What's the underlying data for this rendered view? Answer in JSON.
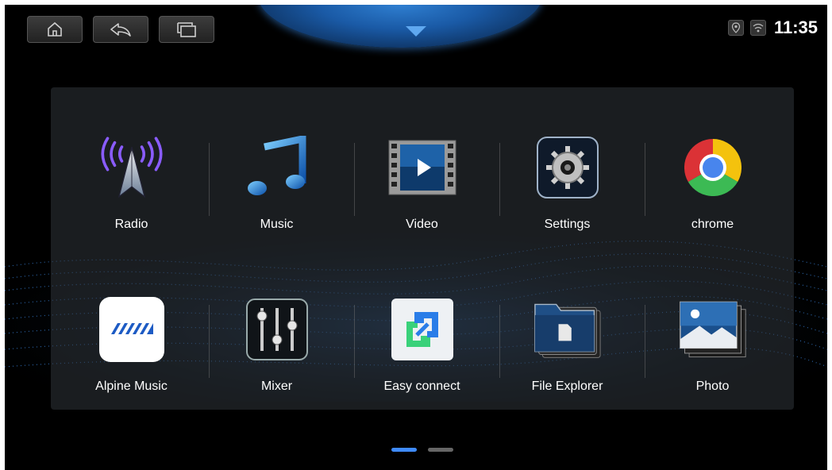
{
  "status": {
    "time": "11:35",
    "location_icon": "location-pin-icon",
    "wifi_icon": "wifi-icon"
  },
  "nav": {
    "buttons": [
      "home-icon",
      "back-icon",
      "recent-apps-icon"
    ]
  },
  "apps": [
    {
      "label": "Radio",
      "icon": "radio-antenna-icon"
    },
    {
      "label": "Music",
      "icon": "music-note-icon"
    },
    {
      "label": "Video",
      "icon": "video-film-icon"
    },
    {
      "label": "Settings",
      "icon": "gear-icon"
    },
    {
      "label": "chrome",
      "icon": "chrome-icon"
    },
    {
      "label": "Alpine Music",
      "icon": "alpine-logo-icon"
    },
    {
      "label": "Mixer",
      "icon": "mixer-sliders-icon"
    },
    {
      "label": "Easy connect",
      "icon": "easy-connect-icon"
    },
    {
      "label": "File Explorer",
      "icon": "folder-icon"
    },
    {
      "label": "Photo",
      "icon": "photo-icon"
    }
  ],
  "pager": {
    "pages": 2,
    "current_page": 1
  },
  "colors": {
    "accent": "#3f8bff",
    "background": "#000000"
  }
}
